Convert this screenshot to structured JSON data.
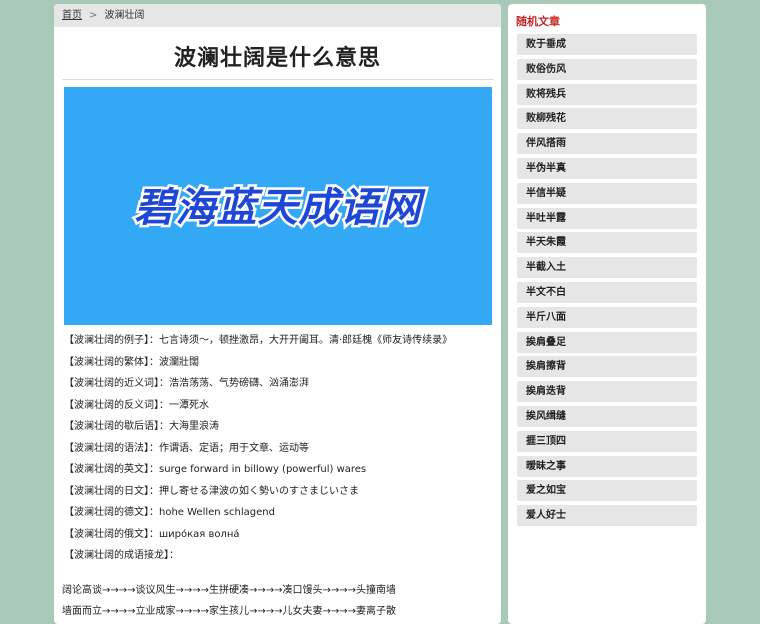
{
  "breadcrumb": {
    "home": "首页",
    "separator": ">",
    "current": "波澜壮阔"
  },
  "page_title": "波澜壮阔是什么意思",
  "banner": {
    "text": "碧海蓝天成语网",
    "bg_color": "#33a9f5",
    "text_color": "#1f47d6"
  },
  "info": [
    {
      "label": "【波澜壮阔的例子】：",
      "value": "七言诗须～，顿挫激昂，大开开阖耳。清·郎廷槐《师友诗传续录》"
    },
    {
      "label": "【波澜壮阔的繁体】：",
      "value": "波瀾壯闊"
    },
    {
      "label": "【波澜壮阔的近义词】：",
      "value": "浩浩荡荡、气势磅礴、汹涌澎湃"
    },
    {
      "label": "【波澜壮阔的反义词】：",
      "value": "一潭死水"
    },
    {
      "label": "【波澜壮阔的歇后语】：",
      "value": "大海里浪涛"
    },
    {
      "label": "【波澜壮阔的语法】：",
      "value": "作谓语、定语；用于文章、运动等"
    },
    {
      "label": "【波澜壮阔的英文】：",
      "value": "surge forward in billowy (powerful) wares"
    },
    {
      "label": "【波澜壮阔的日文】：",
      "value": "押し寄せる津波の如く勢いのすさまじいさま"
    },
    {
      "label": "【波澜壮阔的德文】：",
      "value": "hohe Wellen schlagend"
    },
    {
      "label": "【波澜壮阔的俄文】：",
      "value": "широ́кая волна́"
    },
    {
      "label": "【波澜壮阔的成语接龙】：",
      "value": ""
    }
  ],
  "chain": [
    "阔论高谈→→→→谈议风生→→→→生拼硬凑→→→→凑口馒头→→→→头撞南墙",
    "墙面而立→→→→立业成家→→→→家生孩儿→→→→儿女夫妻→→→→妻离子散"
  ],
  "sidebar": {
    "title": "随机文章",
    "items": [
      "败于垂成",
      "败俗伤风",
      "败将残兵",
      "败柳残花",
      "伴风搭雨",
      "半伪半真",
      "半信半疑",
      "半吐半露",
      "半天朱霞",
      "半截入土",
      "半文不白",
      "半斤八面",
      "挨肩叠足",
      "挨肩擦背",
      "挨肩迭背",
      "挨风缉缝",
      "捱三顶四",
      "暧昧之事",
      "爱之如宝",
      "爱人好士"
    ]
  }
}
